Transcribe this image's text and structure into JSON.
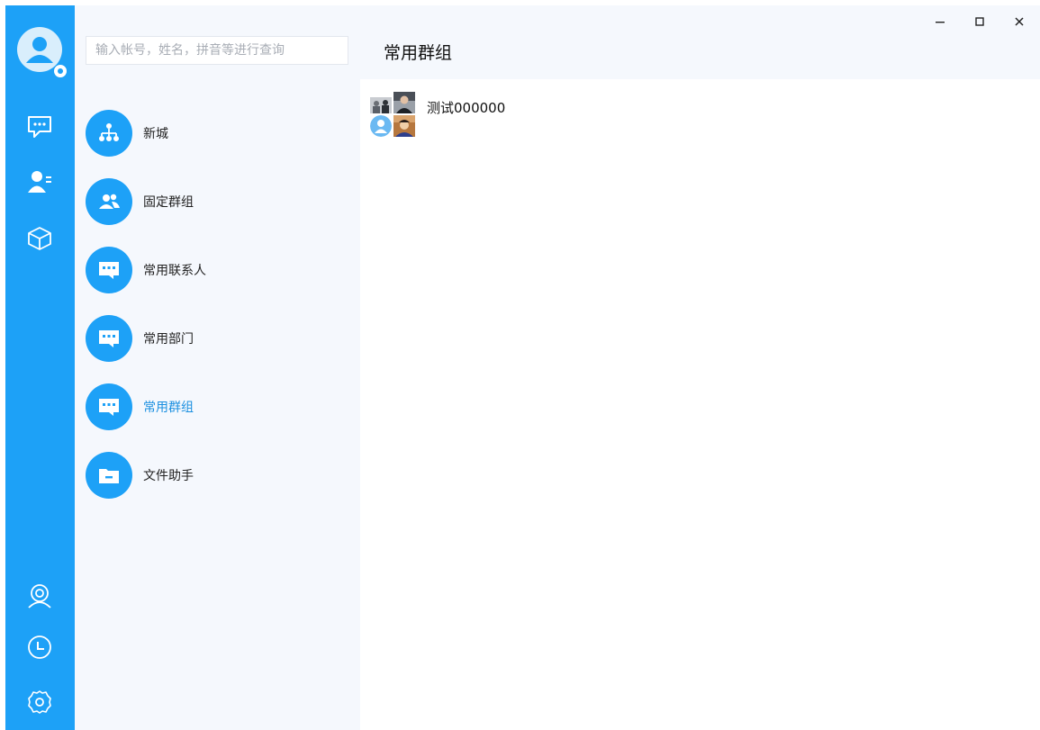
{
  "sidebar": {
    "rail_icons": [
      "chat-icon",
      "contacts-icon",
      "cube-icon",
      "profile-icon",
      "clock-icon",
      "gear-icon"
    ]
  },
  "contacts": {
    "search_placeholder": "输入帐号，姓名，拼音等进行查询",
    "categories": [
      {
        "label": "新城",
        "icon": "org-tree-icon"
      },
      {
        "label": "固定群组",
        "icon": "people-icon"
      },
      {
        "label": "常用联系人",
        "icon": "message-icon"
      },
      {
        "label": "常用部门",
        "icon": "message-icon"
      },
      {
        "label": "常用群组",
        "icon": "message-icon",
        "active": true
      },
      {
        "label": "文件助手",
        "icon": "folder-icon"
      }
    ]
  },
  "main": {
    "title": "常用群组",
    "groups": [
      {
        "name": "测试000000"
      }
    ]
  },
  "colors": {
    "accent": "#1da1f7",
    "active_text": "#1a8fe0",
    "panel_bg": "#f5f8fd"
  }
}
